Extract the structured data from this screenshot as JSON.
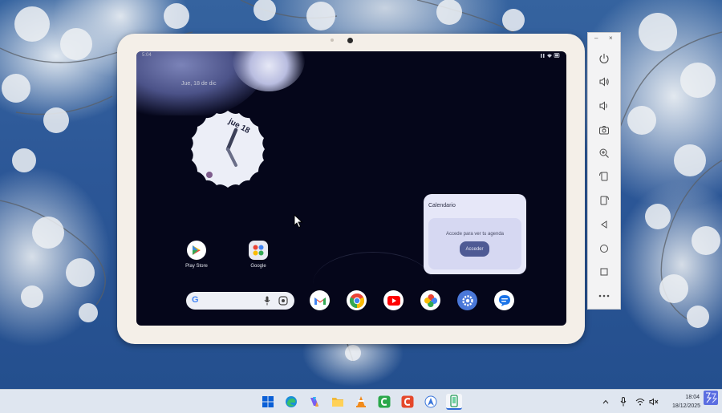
{
  "tablet": {
    "status_time": "5:04",
    "date_label": "Jue, 18 de dic",
    "clock_date": "jue 18",
    "apps": [
      {
        "label": "Play Store",
        "icon": "play-store-icon"
      },
      {
        "label": "Google",
        "icon": "google-folder-icon"
      }
    ],
    "search_letter": "G",
    "dock": [
      "gmail-icon",
      "chrome-icon",
      "youtube-icon",
      "photos-icon",
      "settings-icon",
      "messages-icon"
    ],
    "calendar": {
      "title": "Calendario",
      "message": "Accede para ver tu agenda",
      "button": "Acceder"
    }
  },
  "emulator_toolbar": {
    "window_controls": {
      "minimize": "–",
      "close": "×"
    },
    "buttons": [
      "power-icon",
      "volume-up-icon",
      "volume-down-icon",
      "camera-icon",
      "zoom-icon",
      "rotate-left-icon",
      "rotate-right-icon",
      "back-icon",
      "home-icon",
      "overview-icon",
      "more-icon"
    ]
  },
  "taskbar": {
    "apps": [
      "windows-start-icon",
      "edge-icon",
      "copilot-icon",
      "file-explorer-icon",
      "vlc-icon",
      "camtasia-icon",
      "camtasia-recorder-icon",
      "studio-icon",
      "emulator-icon"
    ],
    "time": "18:04",
    "date": "18/12/2025",
    "tray": [
      "chevron-up-icon",
      "microphone-icon",
      "wifi-icon",
      "speaker-muted-icon"
    ]
  },
  "colors": {
    "wallpaper_sky": "#2c5797",
    "screen_bg": "#05061a",
    "calendar_bg": "#e6e7f8",
    "calendar_button": "#4e5a94",
    "taskbar_bg": "#dfe6f0"
  }
}
